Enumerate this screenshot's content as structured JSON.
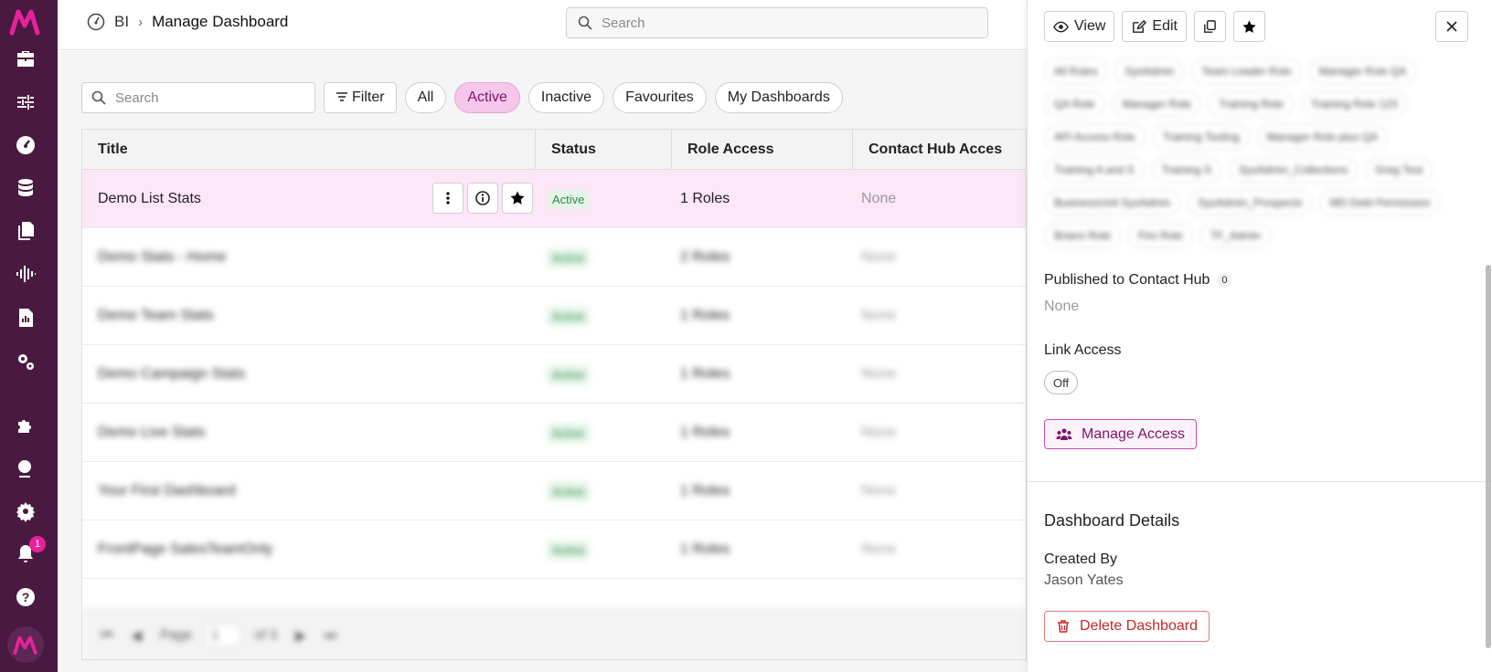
{
  "header": {
    "breadcrumb_root": "BI",
    "breadcrumb_current": "Manage Dashboard",
    "search_placeholder": "Search"
  },
  "sidebar": {
    "notification_count": "1",
    "items": [
      "logo-icon",
      "briefcase-icon",
      "sliders-icon",
      "dashboard-gauge-icon",
      "database-icon",
      "documents-icon",
      "audio-wave-icon",
      "report-icon",
      "cogs-icon",
      "puzzle-icon",
      "globe-icon",
      "settings-icon",
      "bell-icon",
      "help-icon"
    ]
  },
  "toolbar": {
    "search_placeholder": "Search",
    "filter_label": "Filter",
    "pills": [
      "All",
      "Active",
      "Inactive",
      "Favourites",
      "My Dashboards"
    ],
    "active_pill": "Active"
  },
  "table": {
    "columns": [
      "Title",
      "Status",
      "Role Access",
      "Contact Hub Acces"
    ],
    "rows": [
      {
        "title": "Demo List Stats",
        "status": "Active",
        "roles": "1 Roles",
        "hub": "None"
      },
      {
        "title": "Demo Stats - Home",
        "status": "Active",
        "roles": "2 Roles",
        "hub": "None"
      },
      {
        "title": "Demo Team Stats",
        "status": "Active",
        "roles": "1 Roles",
        "hub": "None"
      },
      {
        "title": "Demo Campaign Stats",
        "status": "Active",
        "roles": "1 Roles",
        "hub": "None"
      },
      {
        "title": "Demo Live Stats",
        "status": "Active",
        "roles": "1 Roles",
        "hub": "None"
      },
      {
        "title": "Your First Dashboard",
        "status": "Active",
        "roles": "1 Roles",
        "hub": "None"
      },
      {
        "title": "FrontPage SalesTeamOnly",
        "status": "Active",
        "roles": "1 Roles",
        "hub": "None"
      }
    ],
    "pager": {
      "page_label": "Page",
      "page_value": "1",
      "of_label": "of 3"
    }
  },
  "panel": {
    "view_label": "View",
    "edit_label": "Edit",
    "role_chips": [
      "All Roles",
      "SysAdmin",
      "Team Leader Role",
      "Manager Role QA",
      "QA Role",
      "Manager Role",
      "Training Role",
      "Training Role 123",
      "API Access Role",
      "Training Testing",
      "Manager Role plus QA",
      "Training A and S",
      "Training S",
      "SysAdmin_Collections",
      "Greg Test",
      "BusinessUnit SysAdmin",
      "SysAdmin_Prospects",
      "MD Debt Permission",
      "Brians Role",
      "Fire Role",
      "TF_Admin"
    ],
    "published_label": "Published to Contact Hub",
    "published_count": "0",
    "published_value": "None",
    "link_access_label": "Link Access",
    "link_access_value": "Off",
    "manage_access_label": "Manage Access",
    "details_title": "Dashboard Details",
    "created_by_label": "Created By",
    "created_by_value": "Jason Yates",
    "delete_label": "Delete Dashboard"
  },
  "colors": {
    "sidebar": "#4a1942",
    "accent": "#e8219a",
    "active_pill_bg": "#f7c6ec",
    "selected_row_bg": "#fde6f7",
    "status_green": "#2f8a48",
    "danger": "#c62828"
  }
}
